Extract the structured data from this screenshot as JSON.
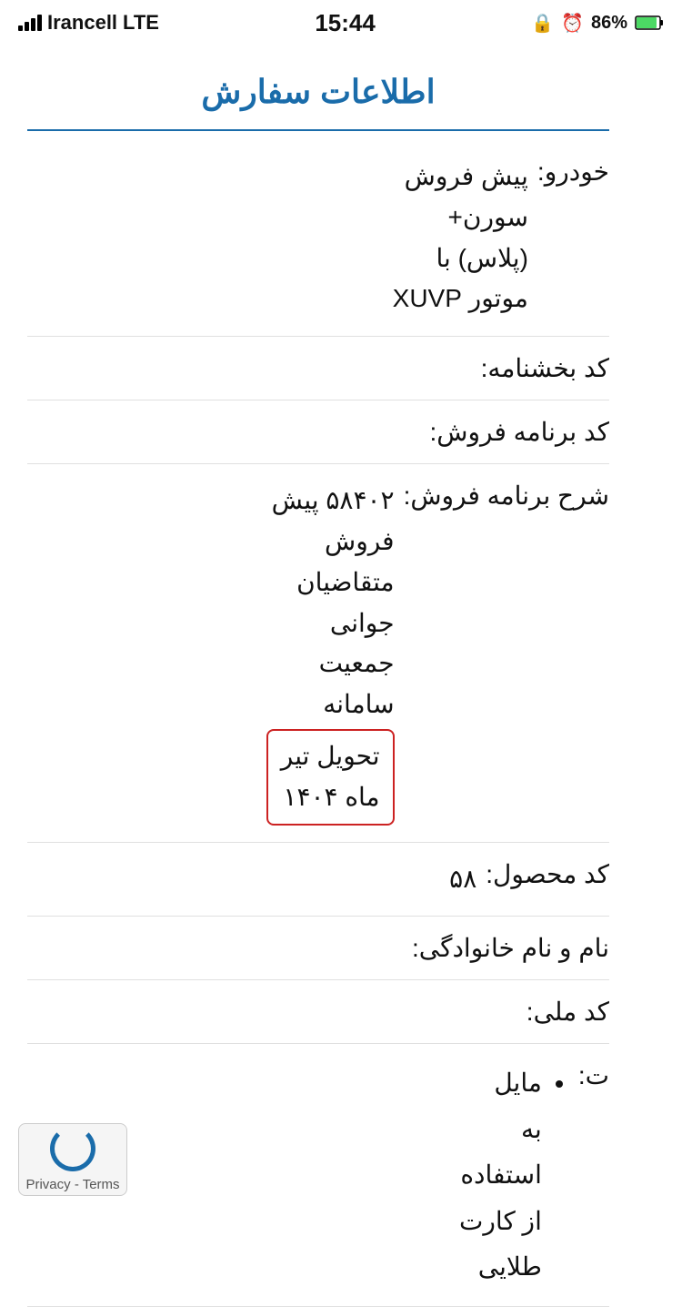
{
  "statusBar": {
    "carrier": "Irancell",
    "networkType": "LTE",
    "time": "15:44",
    "batteryPercent": "86%"
  },
  "page": {
    "title": "اطلاعات سفارش"
  },
  "rows": [
    {
      "label": "خودرو:",
      "value": "پیش فروش\nسورن+\n(پلاس) با\nموتور XUVP",
      "highlight": false
    },
    {
      "label": "کد بخشنامه:",
      "value": "",
      "highlight": false
    },
    {
      "label": "کد برنامه فروش:",
      "value": "",
      "highlight": false
    },
    {
      "label": "شرح برنامه فروش:",
      "value": "۵۸۴۰۲ پیش\nفروش\nمتقاضیان\nجوانی\nجمعیت\nسامانه",
      "highlightedPart": "تحویل تیر\nماه ۱۴۰۴",
      "highlight": true
    },
    {
      "label": "کد محصول:",
      "value": "۵۸",
      "highlight": false
    },
    {
      "label": "نام و نام خانوادگی:",
      "value": "",
      "highlight": false
    },
    {
      "label": "کد ملی:",
      "value": "",
      "highlight": false
    },
    {
      "label": "ت:",
      "value": "• مایل\nبه\nاستفاده\nاز کارت\nطلایی",
      "bullet": true,
      "highlight": false
    }
  ],
  "recaptcha": {
    "privacyText": "Privacy",
    "termsText": "Terms",
    "separator": "-"
  }
}
